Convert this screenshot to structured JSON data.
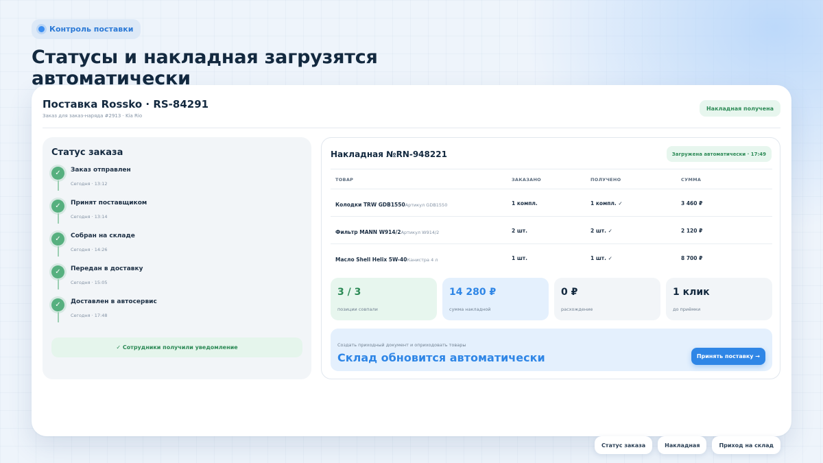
{
  "pill": {
    "label": "Контроль поставки"
  },
  "headline": "Статусы и накладная загрузятся автоматически",
  "card": {
    "title": "Поставка Rossko · RS-84291",
    "subtitle": "Заказ для заказ-наряда #2913 · Kia Rio",
    "badge": "Накладная получена"
  },
  "status": {
    "title": "Статус заказа",
    "items": [
      {
        "name": "Заказ отправлен",
        "time": "Сегодня · 13:12"
      },
      {
        "name": "Принят поставщиком",
        "time": "Сегодня · 13:14"
      },
      {
        "name": "Собран на складе",
        "time": "Сегодня · 14:26"
      },
      {
        "name": "Передан в доставку",
        "time": "Сегодня · 15:05"
      },
      {
        "name": "Доставлен в автосервис",
        "time": "Сегодня · 17:48"
      }
    ],
    "notify": "✓ Сотрудники получили уведомление"
  },
  "invoice": {
    "title": "Накладная №RN-948221",
    "badge": "Загружена автоматически · 17:49",
    "headers": [
      "ТОВАР",
      "ЗАКАЗАНО",
      "ПОЛУЧЕНО",
      "СУММА"
    ],
    "rows": [
      {
        "name": "Колодки TRW GDB1550",
        "article": "Артикул GDB1550",
        "ordered": "1 компл.",
        "received": "1 компл. ✓",
        "sum": "3 460 ₽"
      },
      {
        "name": "Фильтр MANN W914/2",
        "article": "Артикул W914/2",
        "ordered": "2 шт.",
        "received": "2 шт. ✓",
        "sum": "2 120 ₽"
      },
      {
        "name": "Масло Shell Helix 5W-40",
        "article": "Канистра 4 л",
        "ordered": "1 шт.",
        "received": "1 шт. ✓",
        "sum": "8 700 ₽"
      }
    ],
    "stats": [
      {
        "value": "3 / 3",
        "label": "позиции совпали"
      },
      {
        "value": "14 280 ₽",
        "label": "сумма накладной"
      },
      {
        "value": "0 ₽",
        "label": "расхождение"
      },
      {
        "value": "1 клик",
        "label": "до приёмки"
      }
    ],
    "bottom": {
      "small": "Создать приходный документ и оприходовать товары",
      "big": "Склад обновится автоматически",
      "button": "Принять поставку →"
    }
  },
  "tabs": [
    "Статус заказа",
    "Накладная",
    "Приход на склад"
  ],
  "colors": {
    "accent": "#2f86e6",
    "success": "#2c8a56",
    "text": "#13293f"
  }
}
